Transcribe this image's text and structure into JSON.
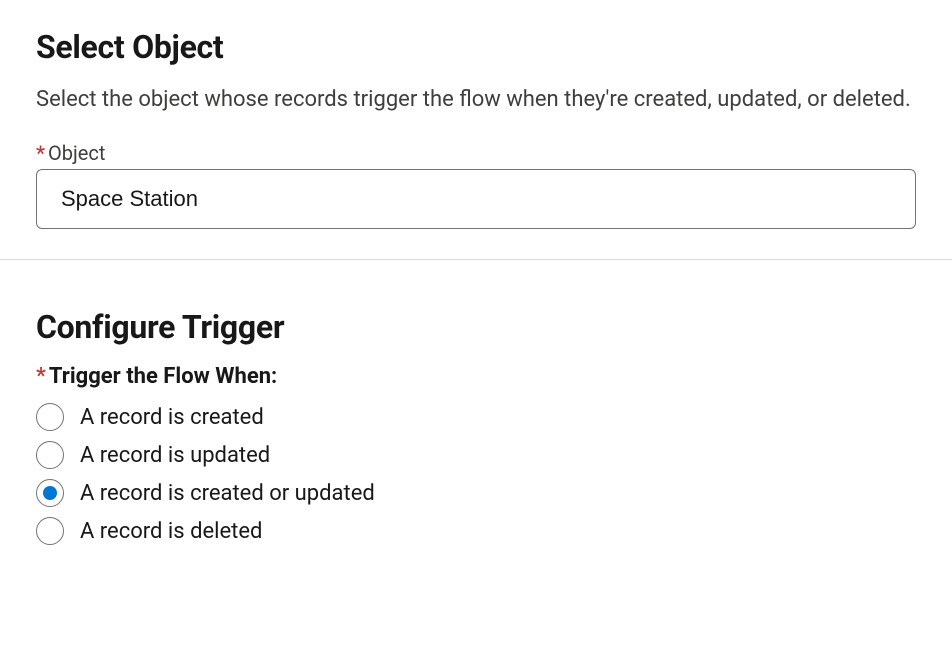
{
  "selectObject": {
    "heading": "Select Object",
    "description": "Select the object whose records trigger the flow when they're created, updated, or deleted.",
    "field": {
      "label": "Object",
      "required": true,
      "value": "Space Station"
    }
  },
  "configureTrigger": {
    "heading": "Configure Trigger",
    "legend": "Trigger the Flow When:",
    "required": true,
    "options": [
      {
        "label": "A record is created",
        "selected": false
      },
      {
        "label": "A record is updated",
        "selected": false
      },
      {
        "label": "A record is created or updated",
        "selected": true
      },
      {
        "label": "A record is deleted",
        "selected": false
      }
    ]
  }
}
